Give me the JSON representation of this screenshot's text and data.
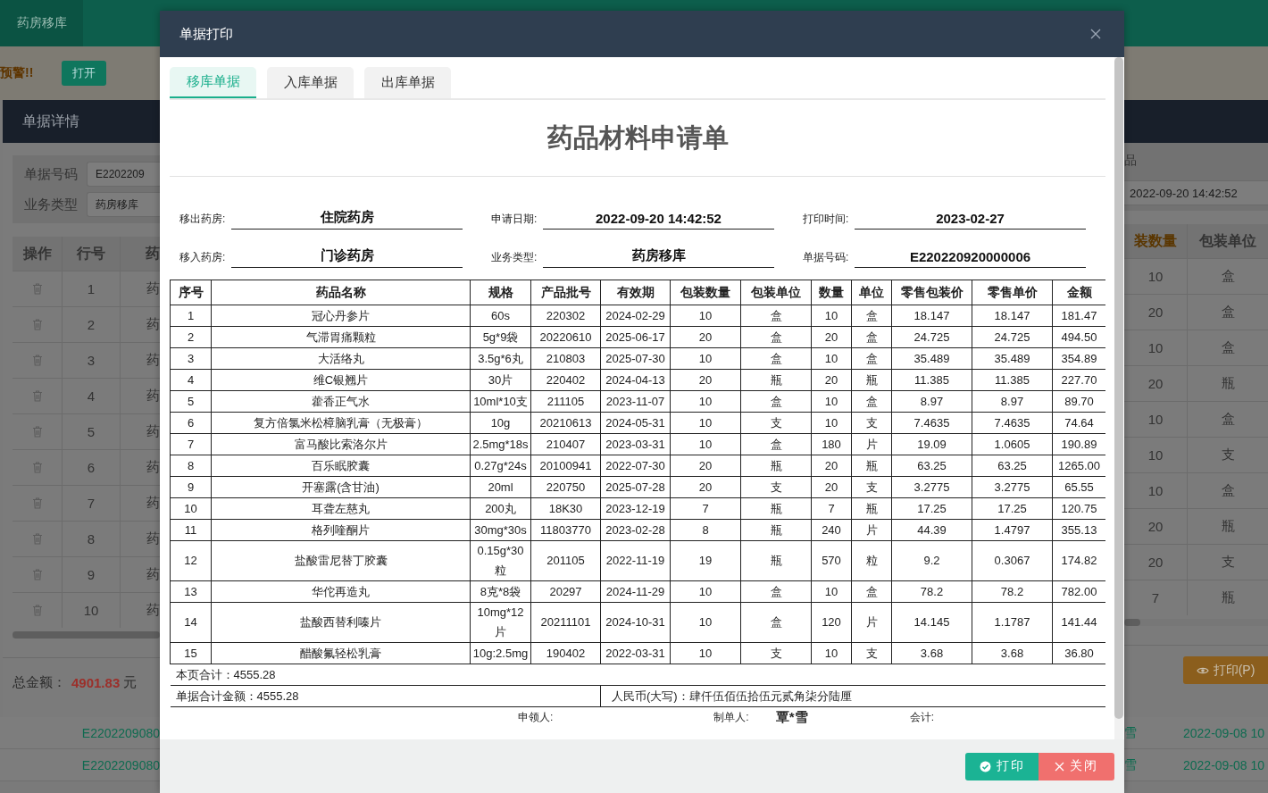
{
  "app_tab": "药房移库",
  "alert": {
    "text": "预警!!",
    "button": "打开"
  },
  "detail_panel": {
    "title": "单据详情",
    "form_left": [
      {
        "label": "单据号码",
        "value": "E2202209"
      },
      {
        "label": "业务类型",
        "value": "药房移库"
      }
    ],
    "form_right": {
      "fragment": "品",
      "value": "2022-09-20 14:42:52"
    },
    "table_left": {
      "columns": [
        "操作",
        "行号",
        "药"
      ],
      "rows": [
        {
          "line": "1",
          "name": "药"
        },
        {
          "line": "2",
          "name": "药"
        },
        {
          "line": "3",
          "name": "药"
        },
        {
          "line": "4",
          "name": "药"
        },
        {
          "line": "5",
          "name": "药"
        },
        {
          "line": "6",
          "name": "药"
        },
        {
          "line": "7",
          "name": "药"
        },
        {
          "line": "8",
          "name": "药"
        },
        {
          "line": "9",
          "name": "药"
        },
        {
          "line": "10",
          "name": "药"
        }
      ]
    },
    "table_right": {
      "columns": [
        {
          "label": "装数量",
          "sorted": true
        },
        {
          "label": "包装单位",
          "sorted": false
        }
      ],
      "rows": [
        {
          "qty": "10",
          "unit": "盒"
        },
        {
          "qty": "20",
          "unit": "盒"
        },
        {
          "qty": "10",
          "unit": "盒"
        },
        {
          "qty": "20",
          "unit": "瓶"
        },
        {
          "qty": "10",
          "unit": "盒"
        },
        {
          "qty": "10",
          "unit": "支"
        },
        {
          "qty": "10",
          "unit": "盒"
        },
        {
          "qty": "20",
          "unit": "瓶"
        },
        {
          "qty": "20",
          "unit": "支"
        },
        {
          "qty": "7",
          "unit": "瓶"
        }
      ]
    },
    "total_label": "总金额：",
    "total_value": "4901.83",
    "total_unit": "元",
    "print_button": "打印(P)"
  },
  "list_rows": [
    {
      "code": "E2202209080",
      "user": "雪",
      "time": "2022-09-08 10"
    },
    {
      "code": "E2202209080",
      "user": "雪",
      "time": "2022-09-08 10"
    }
  ],
  "dialog": {
    "title": "单据打印",
    "tabs": [
      {
        "label": "移库单据",
        "selected": true
      },
      {
        "label": "入库单据",
        "selected": false
      },
      {
        "label": "出库单据",
        "selected": false
      }
    ],
    "form_title": "药品材料申请单",
    "fields": [
      {
        "label": "移出药房:",
        "value": "住院药房"
      },
      {
        "label": "申请日期:",
        "value": "2022-09-20 14:42:52"
      },
      {
        "label": "打印时间:",
        "value": "2023-02-27"
      },
      {
        "label": "移入药房:",
        "value": "门诊药房"
      },
      {
        "label": "业务类型:",
        "value": "药房移库"
      },
      {
        "label": "单据号码:",
        "value": "E220220920000006"
      }
    ],
    "table": {
      "columns": [
        "序号",
        "药品名称",
        "规格",
        "产品批号",
        "有效期",
        "包装数量",
        "包装单位",
        "数量",
        "单位",
        "零售包装价",
        "零售单价",
        "金额"
      ],
      "rows": [
        [
          "1",
          "冠心丹参片",
          "60s",
          "220302",
          "2024-02-29",
          "10",
          "盒",
          "10",
          "盒",
          "18.147",
          "18.147",
          "181.47"
        ],
        [
          "2",
          "气滞胃痛颗粒",
          "5g*9袋",
          "20220610",
          "2025-06-17",
          "20",
          "盒",
          "20",
          "盒",
          "24.725",
          "24.725",
          "494.50"
        ],
        [
          "3",
          "大活络丸",
          "3.5g*6丸",
          "210803",
          "2025-07-30",
          "10",
          "盒",
          "10",
          "盒",
          "35.489",
          "35.489",
          "354.89"
        ],
        [
          "4",
          "维C银翘片",
          "30片",
          "220402",
          "2024-04-13",
          "20",
          "瓶",
          "20",
          "瓶",
          "11.385",
          "11.385",
          "227.70"
        ],
        [
          "5",
          "藿香正气水",
          "10ml*10支",
          "211105",
          "2023-11-07",
          "10",
          "盒",
          "10",
          "盒",
          "8.97",
          "8.97",
          "89.70"
        ],
        [
          "6",
          "复方倍氯米松樟脑乳膏（无极膏）",
          "10g",
          "20210613",
          "2024-05-31",
          "10",
          "支",
          "10",
          "支",
          "7.4635",
          "7.4635",
          "74.64"
        ],
        [
          "7",
          "富马酸比索洛尔片",
          "2.5mg*18s",
          "210407",
          "2023-03-31",
          "10",
          "盒",
          "180",
          "片",
          "19.09",
          "1.0605",
          "190.89"
        ],
        [
          "8",
          "百乐眠胶囊",
          "0.27g*24s",
          "20100941",
          "2022-07-30",
          "20",
          "瓶",
          "20",
          "瓶",
          "63.25",
          "63.25",
          "1265.00"
        ],
        [
          "9",
          "开塞露(含甘油)",
          "20ml",
          "220750",
          "2025-07-28",
          "20",
          "支",
          "20",
          "支",
          "3.2775",
          "3.2775",
          "65.55"
        ],
        [
          "10",
          "耳聋左慈丸",
          "200丸",
          "18K30",
          "2023-12-19",
          "7",
          "瓶",
          "7",
          "瓶",
          "17.25",
          "17.25",
          "120.75"
        ],
        [
          "11",
          "格列喹酮片",
          "30mg*30s",
          "11803770",
          "2023-02-28",
          "8",
          "瓶",
          "240",
          "片",
          "44.39",
          "1.4797",
          "355.13"
        ],
        [
          "12",
          "盐酸雷尼替丁胶囊",
          "0.15g*30粒",
          "201105",
          "2022-11-19",
          "19",
          "瓶",
          "570",
          "粒",
          "9.2",
          "0.3067",
          "174.82"
        ],
        [
          "13",
          "华佗再造丸",
          "8克*8袋",
          "20297",
          "2024-11-29",
          "10",
          "盒",
          "10",
          "盒",
          "78.2",
          "78.2",
          "782.00"
        ],
        [
          "14",
          "盐酸西替利嗪片",
          "10mg*12片",
          "20211101",
          "2024-10-31",
          "10",
          "盒",
          "120",
          "片",
          "14.145",
          "1.1787",
          "141.44"
        ],
        [
          "15",
          "醋酸氟轻松乳膏",
          "10g:2.5mg",
          "190402",
          "2022-03-31",
          "10",
          "支",
          "10",
          "支",
          "3.68",
          "3.68",
          "36.80"
        ]
      ]
    },
    "page_total": "本页合计：4555.28",
    "grand_total": "单据合计金额：4555.28",
    "amount_in_words": "人民币(大写)：肆仟伍佰伍拾伍元贰角柒分陆厘",
    "signatures": [
      {
        "label": "申领人:"
      },
      {
        "label": "制单人:",
        "value": "覃*雪"
      },
      {
        "label": "会计:"
      }
    ],
    "buttons": [
      {
        "kind": "confirm",
        "label": "打印"
      },
      {
        "kind": "cancel",
        "label": "关闭"
      }
    ]
  }
}
